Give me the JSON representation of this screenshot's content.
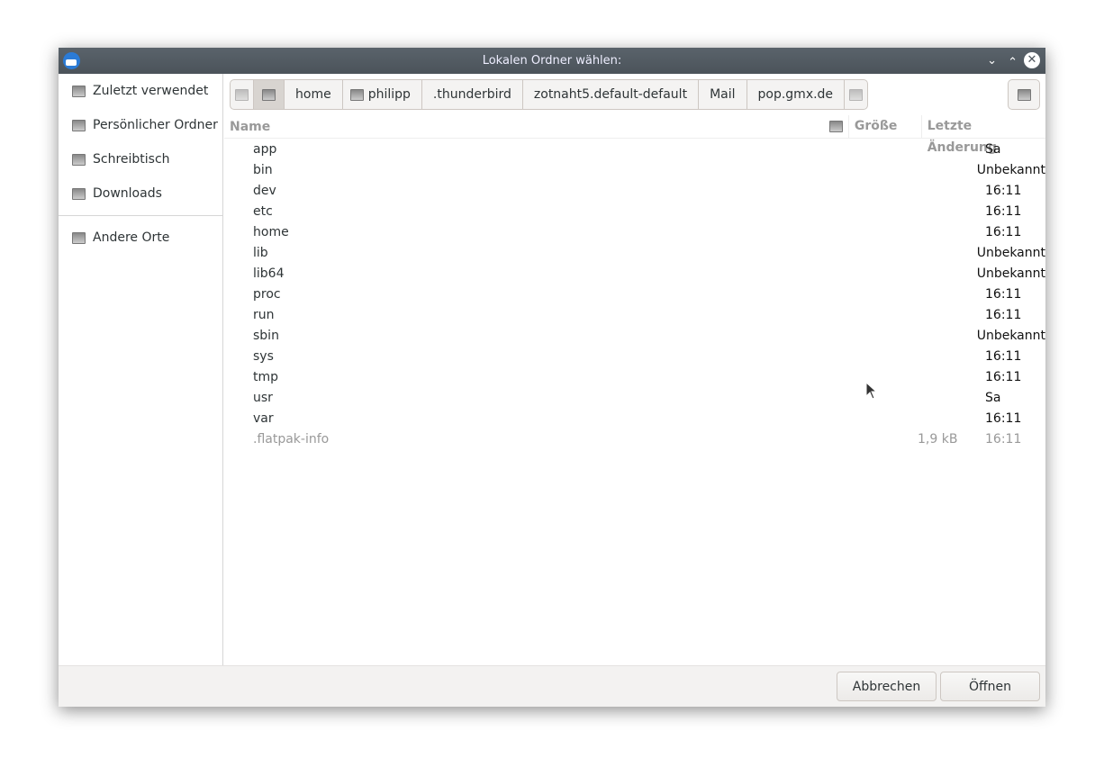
{
  "title": "Lokalen Ordner wählen:",
  "sidebar": {
    "items": [
      {
        "label": "Zuletzt verwendet"
      },
      {
        "label": "Persönlicher Ordner"
      },
      {
        "label": "Schreibtisch"
      },
      {
        "label": "Downloads"
      }
    ],
    "other": {
      "label": "Andere Orte"
    }
  },
  "path": [
    "home",
    "philipp",
    ".thunderbird",
    "zotnaht5.default-default",
    "Mail",
    "pop.gmx.de"
  ],
  "columns": {
    "name": "Name",
    "size": "Größe",
    "modified": "Letzte Änderung"
  },
  "files": [
    {
      "name": "app",
      "size": "",
      "modified": "Sa"
    },
    {
      "name": "bin",
      "size": "",
      "modified": "Unbekannt"
    },
    {
      "name": "dev",
      "size": "",
      "modified": "16:11"
    },
    {
      "name": "etc",
      "size": "",
      "modified": "16:11"
    },
    {
      "name": "home",
      "size": "",
      "modified": "16:11"
    },
    {
      "name": "lib",
      "size": "",
      "modified": "Unbekannt"
    },
    {
      "name": "lib64",
      "size": "",
      "modified": "Unbekannt"
    },
    {
      "name": "proc",
      "size": "",
      "modified": "16:11"
    },
    {
      "name": "run",
      "size": "",
      "modified": "16:11"
    },
    {
      "name": "sbin",
      "size": "",
      "modified": "Unbekannt"
    },
    {
      "name": "sys",
      "size": "",
      "modified": "16:11"
    },
    {
      "name": "tmp",
      "size": "",
      "modified": "16:11"
    },
    {
      "name": "usr",
      "size": "",
      "modified": "Sa"
    },
    {
      "name": "var",
      "size": "",
      "modified": "16:11"
    },
    {
      "name": ".flatpak-info",
      "size": "1,9 kB",
      "modified": "16:11"
    }
  ],
  "buttons": {
    "cancel": "Abbrechen",
    "open": "Öffnen"
  }
}
